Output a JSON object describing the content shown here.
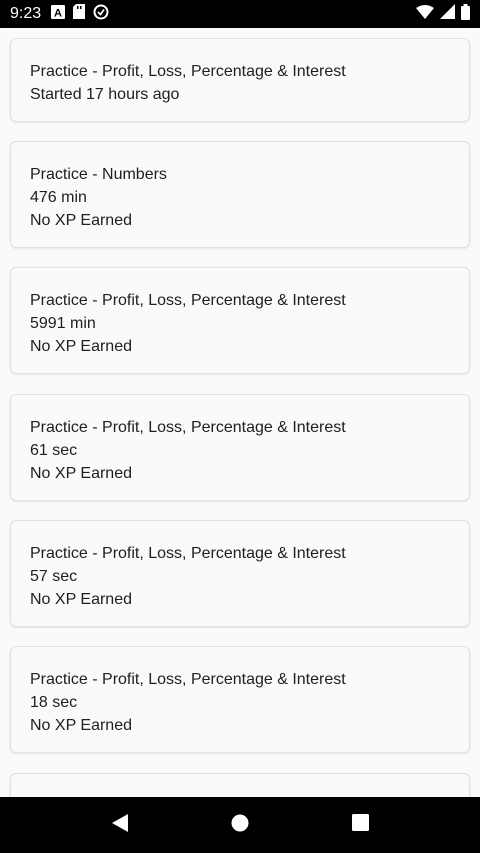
{
  "status_bar": {
    "time": "9:23",
    "left_icons": [
      "font-a-icon",
      "sd-card-icon",
      "data-saver-icon"
    ],
    "right_icons": [
      "wifi-icon",
      "cellular-signal-icon",
      "battery-icon"
    ]
  },
  "cards": [
    {
      "title": "Practice - Profit, Loss, Percentage & Interest",
      "detail": "Started 17 hours ago",
      "xp": ""
    },
    {
      "title": "Practice - Numbers",
      "detail": "476 min",
      "xp": "No XP Earned"
    },
    {
      "title": "Practice - Profit, Loss, Percentage & Interest",
      "detail": "5991 min",
      "xp": "No XP Earned"
    },
    {
      "title": "Practice - Profit, Loss, Percentage & Interest",
      "detail": "61 sec",
      "xp": "No XP Earned"
    },
    {
      "title": "Practice - Profit, Loss, Percentage & Interest",
      "detail": "57 sec",
      "xp": "No XP Earned"
    },
    {
      "title": "Practice - Profit, Loss, Percentage & Interest",
      "detail": "18 sec",
      "xp": "No XP Earned"
    }
  ],
  "nav_bar": {
    "buttons": [
      "back-icon",
      "home-icon",
      "recents-icon"
    ]
  }
}
